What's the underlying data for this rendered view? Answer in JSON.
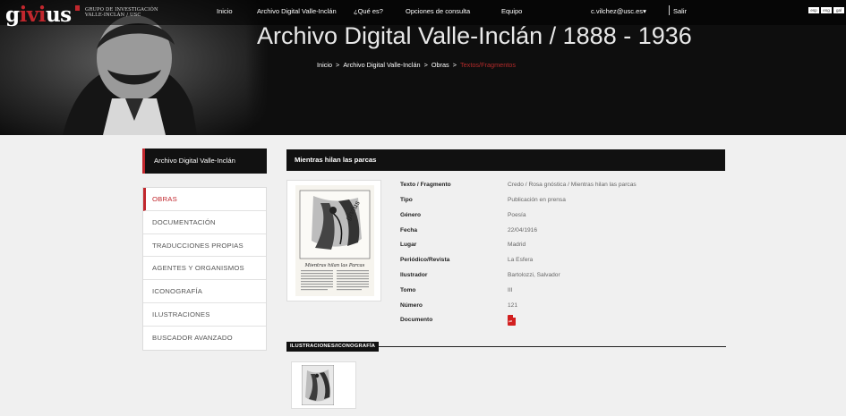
{
  "logo": {
    "text_a": "g",
    "text_b": "ivi",
    "text_c": "us",
    "sub_line1": "GRUPO DE INVESTIGACIÓN",
    "sub_line2": "VALLE-INCLÁN / USC"
  },
  "nav": [
    "Inicio",
    "Archivo Digital Valle-Inclán",
    "¿Qué es?",
    "Opciones de consulta",
    "Equipo"
  ],
  "user": {
    "email": "c.vilchez@usc.es",
    "caret": "▾",
    "logout": "Salir"
  },
  "languages": [
    "esp",
    "eng",
    "gal"
  ],
  "hero": {
    "title": "Archivo Digital Valle-Inclán / 1888 - 1936"
  },
  "breadcrumb": {
    "items": [
      "Inicio",
      "Archivo Digital Valle-Inclán",
      "Obras"
    ],
    "current": "Textos/Fragmentos",
    "separator": ">"
  },
  "sidebar": {
    "heading": "Archivo Digital Valle-Inclán",
    "items": [
      "OBRAS",
      "DOCUMENTACIÓN",
      "TRADUCCIONES PROPIAS",
      "AGENTES Y ORGANISMOS",
      "ICONOGRAFÍA",
      "ILUSTRACIONES",
      "BUSCADOR AVANZADO"
    ],
    "active_index": 0
  },
  "record": {
    "title": "Mientras hilan las parcas",
    "thumbnail_caption": "Mientras hilan las Parcas",
    "fields": [
      {
        "label": "Texto / Fragmento",
        "value": "Credo / Rosa gnóstica / Mientras hilan las parcas"
      },
      {
        "label": "Tipo",
        "value": "Publicación en prensa"
      },
      {
        "label": "Género",
        "value": "Poesía"
      },
      {
        "label": "Fecha",
        "value": "22/04/1916"
      },
      {
        "label": "Lugar",
        "value": "Madrid"
      },
      {
        "label": "Periódico/Revista",
        "value": "La Esfera"
      },
      {
        "label": "Ilustrador",
        "value": "Bartolozzi, Salvador"
      },
      {
        "label": "Tomo",
        "value": "III"
      },
      {
        "label": "Número",
        "value": "121"
      },
      {
        "label": "Documento",
        "value": ""
      }
    ],
    "document_icon": "pdf-icon",
    "document_icon_text": "pdf"
  },
  "illustrations": {
    "heading": "ILUSTRACIONES/ICONOGRAFÍA"
  },
  "colors": {
    "accent": "#c1272d",
    "dark": "#111111",
    "background": "#f0f0f0"
  }
}
